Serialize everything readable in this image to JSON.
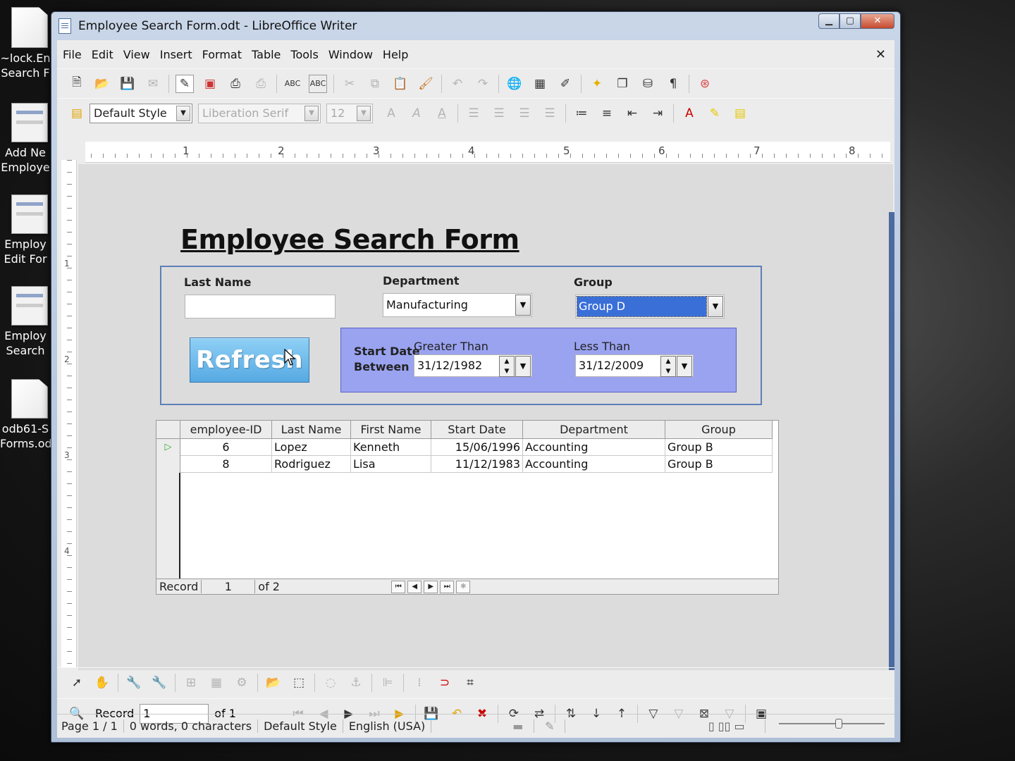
{
  "desktop": {
    "icons": [
      {
        "label": "~lock.En\nSearch F",
        "icon": "lock-file-icon"
      },
      {
        "label": "Add Ne\nEmploye",
        "icon": "form-thumbnail-icon"
      },
      {
        "label": "Employ\nEdit For",
        "icon": "form-thumbnail-icon"
      },
      {
        "label": "Employ\nSearch",
        "icon": "form-thumbnail-icon"
      },
      {
        "label": "odb61-S\nForms.od",
        "icon": "document-icon"
      }
    ]
  },
  "window": {
    "title": "Employee Search Form.odt - LibreOffice Writer",
    "min_label": "▁",
    "max_label": "▢",
    "close_label": "✕"
  },
  "menu": {
    "items": [
      "File",
      "Edit",
      "View",
      "Insert",
      "Format",
      "Table",
      "Tools",
      "Window",
      "Help"
    ],
    "close_label": "✕"
  },
  "formatting": {
    "style": "Default Style",
    "font": "Liberation Serif",
    "size": "12"
  },
  "ruler": {
    "numbers": [
      "1",
      "2",
      "3",
      "4",
      "5",
      "6",
      "7",
      "8"
    ],
    "vertical_numbers": [
      "1",
      "2",
      "3",
      "4"
    ]
  },
  "form": {
    "title": "Employee Search Form",
    "last_name_label": "Last Name",
    "last_name_value": "",
    "department_label": "Department",
    "department_value": "Manufacturing",
    "group_label": "Group",
    "group_value": "Group D",
    "refresh_label": "Refresh",
    "start_date_label": "Start Date",
    "between_label": "Between",
    "greater_than_label": "Greater Than",
    "greater_than_value": "31/12/1982",
    "less_than_label": "Less Than",
    "less_than_value": "31/12/2009",
    "date_box_color": "#9aa3f0",
    "refresh_color": "#56a9e3"
  },
  "grid": {
    "columns": [
      "employee-ID",
      "Last Name",
      "First Name",
      "Start Date",
      "Department",
      "Group"
    ],
    "rows": [
      {
        "id": "6",
        "last": "Lopez",
        "first": "Kenneth",
        "start": "15/06/1996",
        "dept": "Accounting",
        "group": "Group B"
      },
      {
        "id": "8",
        "last": "Rodriguez",
        "first": "Lisa",
        "start": "11/12/1983",
        "dept": "Accounting",
        "group": "Group B"
      }
    ],
    "nav": {
      "record_label": "Record",
      "record_value": "1",
      "of_label": "of 2"
    }
  },
  "form_nav": {
    "record_label": "Record",
    "record_value": "1",
    "of_label": "of 1"
  },
  "status": {
    "page": "Page 1 / 1",
    "words": "0 words, 0 characters",
    "style": "Default Style",
    "language": "English (USA)"
  }
}
